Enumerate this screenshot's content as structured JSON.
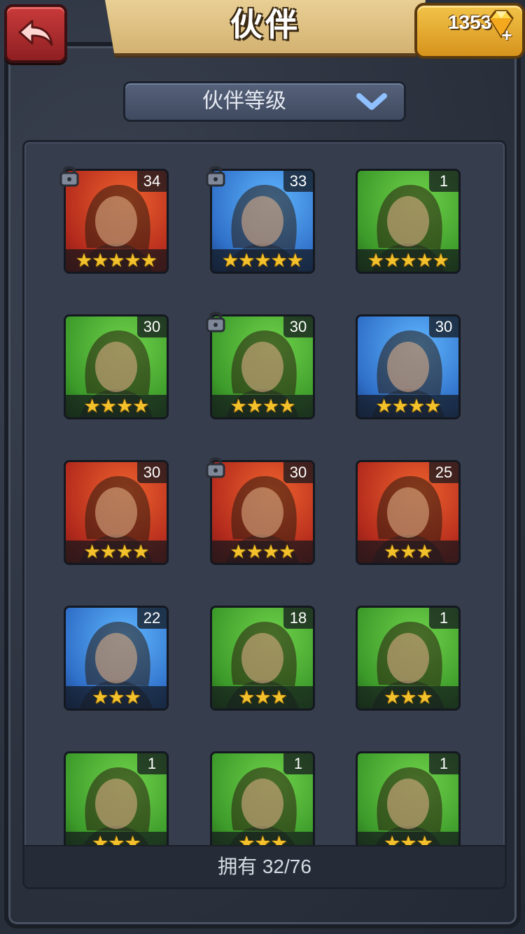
{
  "header": {
    "title": "伙伴",
    "currency_value": "1353"
  },
  "filter": {
    "label": "伙伴等级"
  },
  "heroes": [
    {
      "level": "34",
      "stars": "★★★★★",
      "locked": true,
      "bg": "red"
    },
    {
      "level": "33",
      "stars": "★★★★★",
      "locked": true,
      "bg": "blue"
    },
    {
      "level": "1",
      "stars": "★★★★★",
      "locked": false,
      "bg": "green"
    },
    {
      "level": "30",
      "stars": "★★★★",
      "locked": false,
      "bg": "green"
    },
    {
      "level": "30",
      "stars": "★★★★",
      "locked": true,
      "bg": "green"
    },
    {
      "level": "30",
      "stars": "★★★★",
      "locked": false,
      "bg": "blue"
    },
    {
      "level": "30",
      "stars": "★★★★",
      "locked": false,
      "bg": "red"
    },
    {
      "level": "30",
      "stars": "★★★★",
      "locked": true,
      "bg": "red"
    },
    {
      "level": "25",
      "stars": "★★★",
      "locked": false,
      "bg": "red"
    },
    {
      "level": "22",
      "stars": "★★★",
      "locked": false,
      "bg": "blue"
    },
    {
      "level": "18",
      "stars": "★★★",
      "locked": false,
      "bg": "green"
    },
    {
      "level": "1",
      "stars": "★★★",
      "locked": false,
      "bg": "green"
    },
    {
      "level": "1",
      "stars": "★★★",
      "locked": false,
      "bg": "green"
    },
    {
      "level": "1",
      "stars": "★★★",
      "locked": false,
      "bg": "green"
    },
    {
      "level": "1",
      "stars": "★★★",
      "locked": false,
      "bg": "green"
    }
  ],
  "footer": {
    "owned_text": "拥有 32/76"
  },
  "colors": {
    "accent_gold": "#f3c12b",
    "back_red": "#c93a3a",
    "panel": "#363d4c"
  }
}
